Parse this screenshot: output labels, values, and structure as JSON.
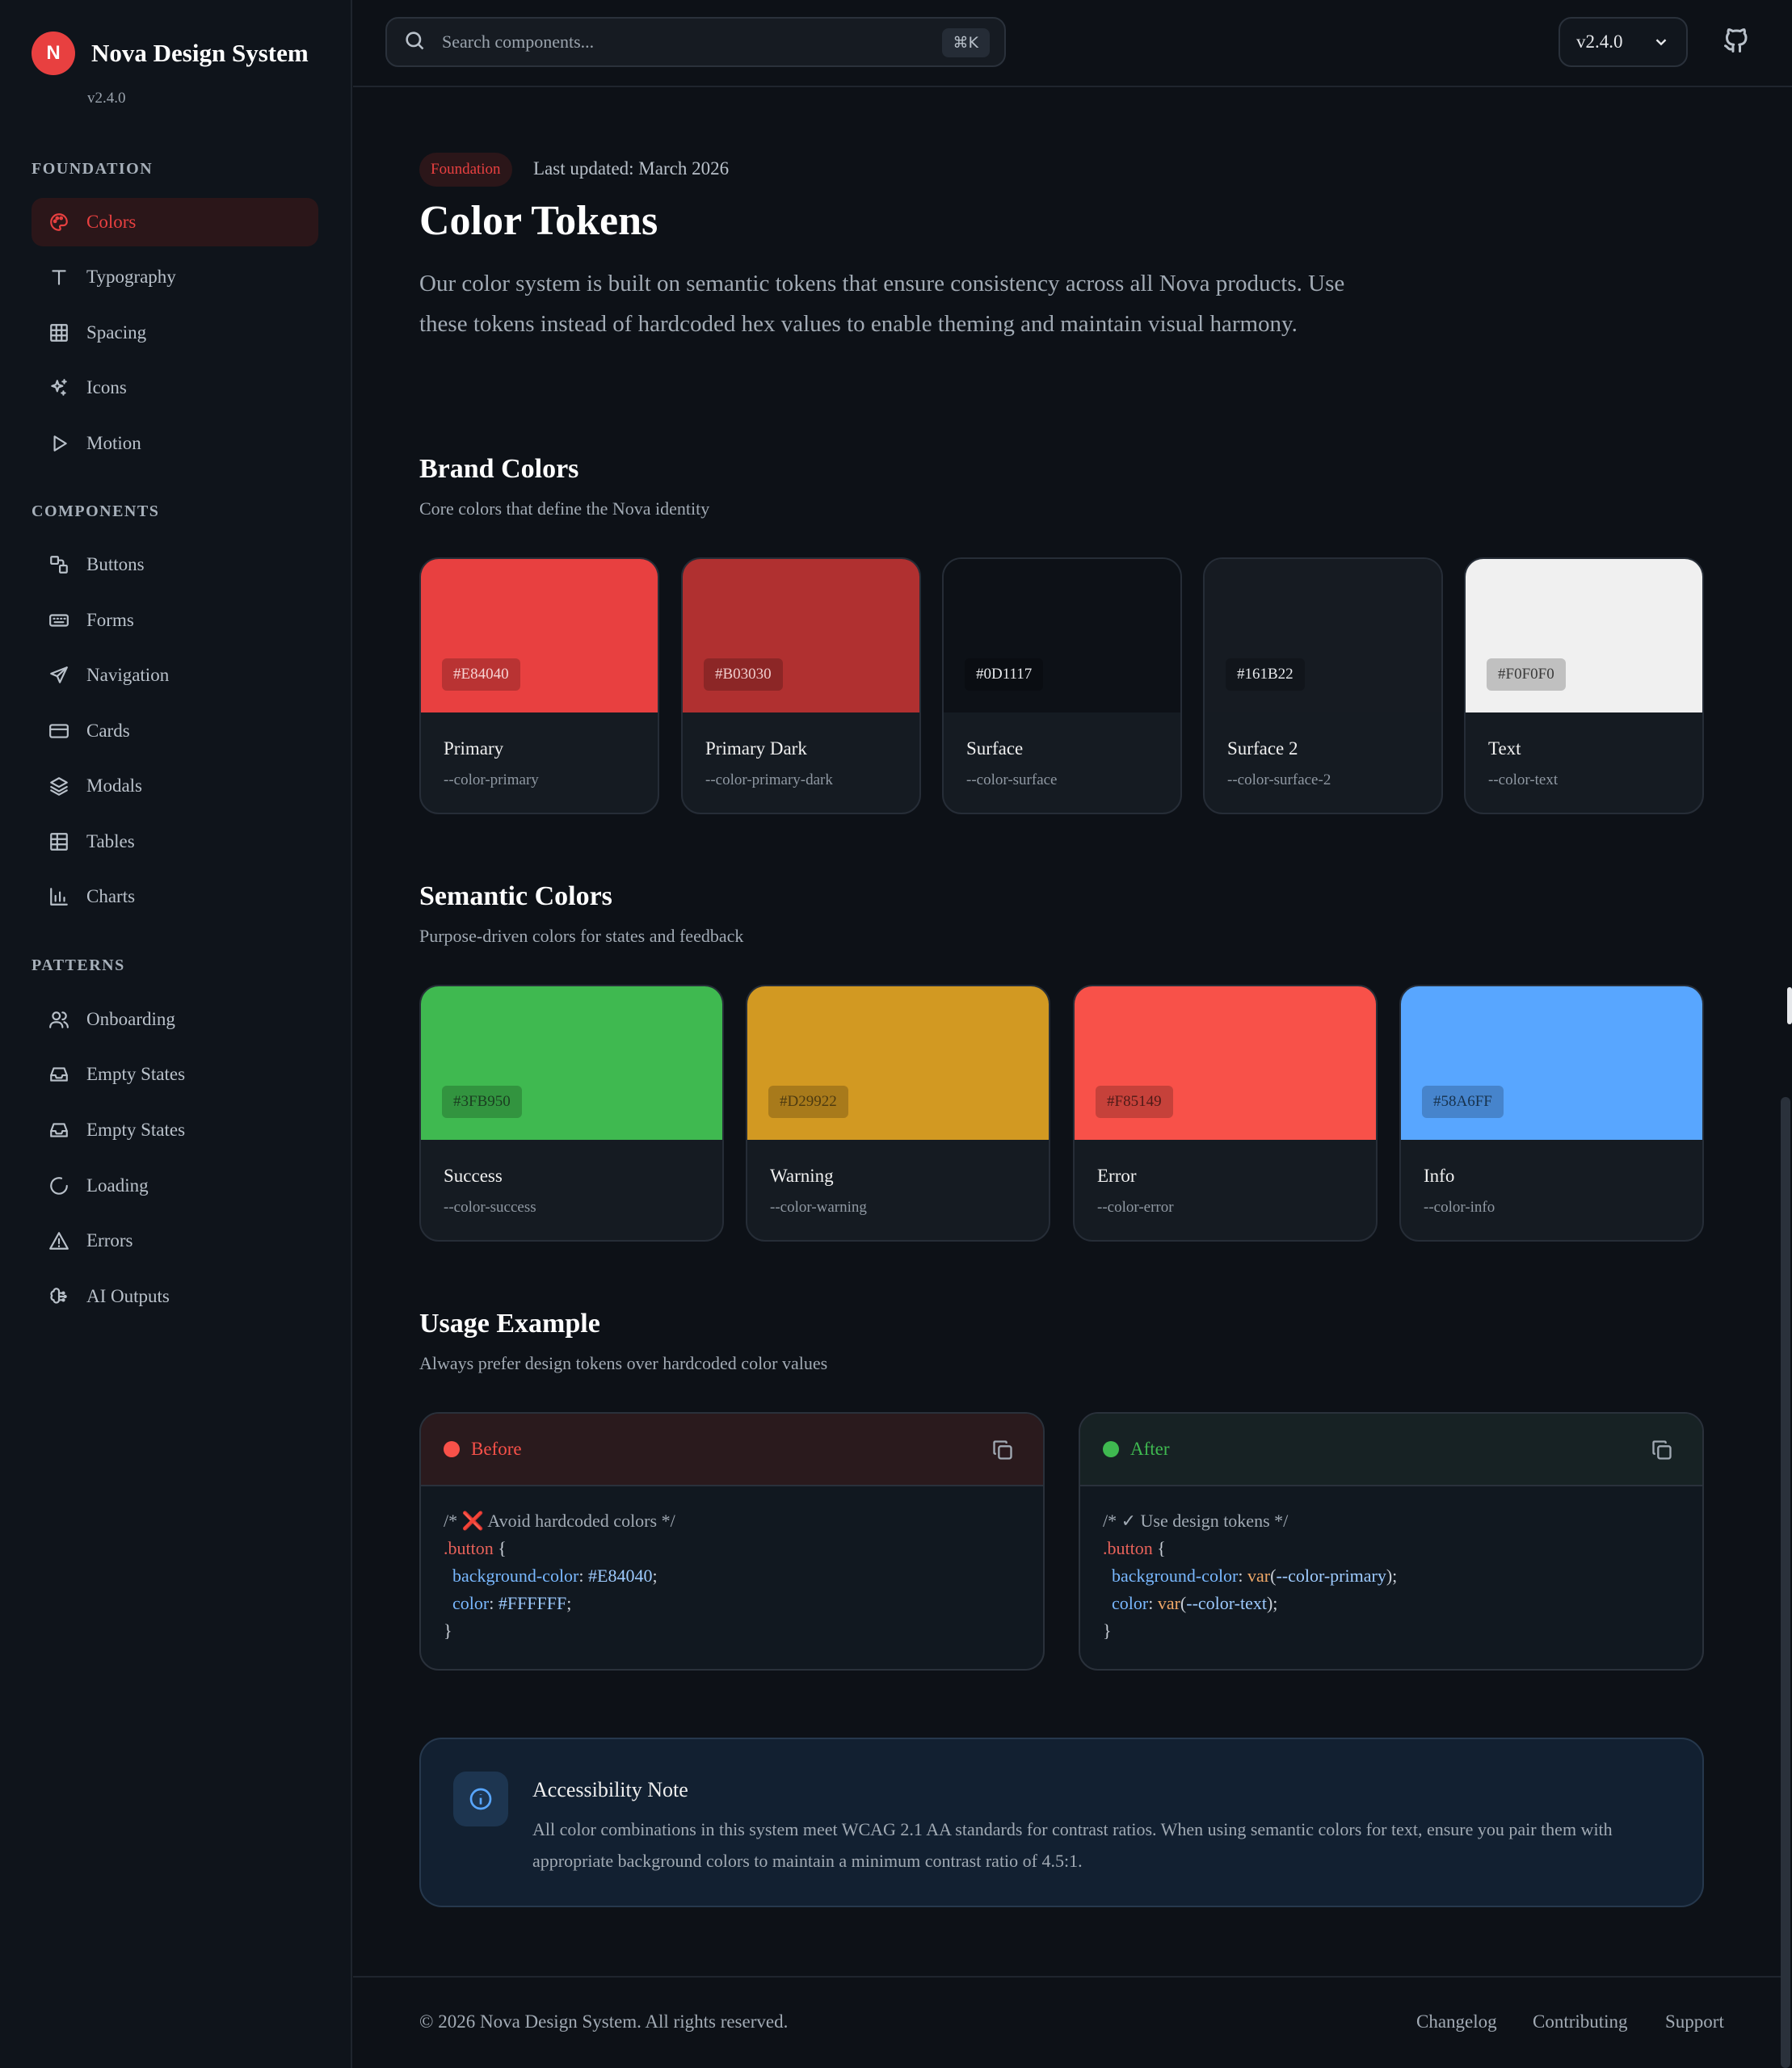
{
  "brand": {
    "logo_letter": "N",
    "name": "Nova Design System",
    "version": "v2.4.0",
    "color": "#E84040"
  },
  "sidebar": {
    "sections": [
      {
        "title": "FOUNDATION",
        "items": [
          {
            "label": "Colors",
            "icon": "palette-icon",
            "active": true
          },
          {
            "label": "Typography",
            "icon": "type-icon"
          },
          {
            "label": "Spacing",
            "icon": "grid-icon"
          },
          {
            "label": "Icons",
            "icon": "sparkle-icon"
          },
          {
            "label": "Motion",
            "icon": "play-icon"
          }
        ]
      },
      {
        "title": "COMPONENTS",
        "items": [
          {
            "label": "Buttons",
            "icon": "shapes-icon"
          },
          {
            "label": "Forms",
            "icon": "keyboard-icon"
          },
          {
            "label": "Navigation",
            "icon": "send-icon"
          },
          {
            "label": "Cards",
            "icon": "card-icon"
          },
          {
            "label": "Modals",
            "icon": "layers-icon"
          },
          {
            "label": "Tables",
            "icon": "table-icon"
          },
          {
            "label": "Charts",
            "icon": "bar-chart-icon"
          }
        ]
      },
      {
        "title": "PATTERNS",
        "items": [
          {
            "label": "Onboarding",
            "icon": "users-icon"
          },
          {
            "label": "Empty States",
            "icon": "inbox-icon"
          },
          {
            "label": "Empty States",
            "icon": "inbox-icon"
          },
          {
            "label": "Loading",
            "icon": "loader-icon"
          },
          {
            "label": "Errors",
            "icon": "warning-icon"
          },
          {
            "label": "AI Outputs",
            "icon": "brain-icon"
          }
        ]
      }
    ]
  },
  "topbar": {
    "search_placeholder": "Search components...",
    "shortcut": "⌘K",
    "version": "v2.4.0"
  },
  "page": {
    "badge": "Foundation",
    "last_updated": "Last updated: March 2026",
    "title": "Color Tokens",
    "intro": "Our color system is built on semantic tokens that ensure consistency across all Nova products. Use these tokens instead of hardcoded hex values to enable theming and maintain visual harmony."
  },
  "brand_colors": {
    "title": "Brand Colors",
    "subtitle": "Core colors that define the Nova identity",
    "swatches": [
      {
        "hex": "#E84040",
        "name": "Primary",
        "token": "--color-primary"
      },
      {
        "hex": "#B03030",
        "name": "Primary Dark",
        "token": "--color-primary-dark"
      },
      {
        "hex": "#0D1117",
        "name": "Surface",
        "token": "--color-surface"
      },
      {
        "hex": "#161B22",
        "name": "Surface 2",
        "token": "--color-surface-2"
      },
      {
        "hex": "#F0F0F0",
        "name": "Text",
        "token": "--color-text"
      }
    ]
  },
  "semantic_colors": {
    "title": "Semantic Colors",
    "subtitle": "Purpose-driven colors for states and feedback",
    "swatches": [
      {
        "hex": "#3FB950",
        "name": "Success",
        "token": "--color-success"
      },
      {
        "hex": "#D29922",
        "name": "Warning",
        "token": "--color-warning"
      },
      {
        "hex": "#F85149",
        "name": "Error",
        "token": "--color-error"
      },
      {
        "hex": "#58A6FF",
        "name": "Info",
        "token": "--color-info"
      }
    ]
  },
  "usage": {
    "title": "Usage Example",
    "subtitle": "Always prefer design tokens over hardcoded color values",
    "before": {
      "label": "Before",
      "comment_open": "/* ",
      "mark": "❌",
      "comment_text": " Avoid hardcoded colors */",
      "selector": ".button",
      "brace_open": " {",
      "prop1": "background-color",
      "val1": "#E84040",
      "prop2": "color",
      "val2": "#FFFFFF",
      "brace_close": "}"
    },
    "after": {
      "label": "After",
      "comment": "/* ✓ Use design tokens */",
      "selector": ".button",
      "brace_open": " {",
      "prop1": "background-color",
      "fn": "var",
      "val1": "--color-primary",
      "prop2": "color",
      "val2": "--color-text",
      "brace_close": "}"
    }
  },
  "note": {
    "title": "Accessibility Note",
    "text": "All color combinations in this system meet WCAG 2.1 AA standards for contrast ratios. When using semantic colors for text, ensure you pair them with appropriate background colors to maintain a minimum contrast ratio of 4.5:1."
  },
  "footer": {
    "copyright": "© 2026 Nova Design System. All rights reserved.",
    "links": [
      "Changelog",
      "Contributing",
      "Support"
    ]
  }
}
